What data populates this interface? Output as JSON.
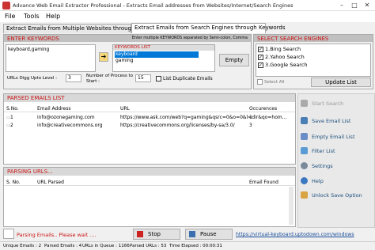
{
  "window": {
    "title": "Advance Web Email Extractor Professional - Extracts Email addresses from Websites/Internet/Search Engines",
    "minimize": "–",
    "maximize": "□",
    "close": "✕"
  },
  "menu": [
    "File",
    "Tools",
    "Help"
  ],
  "tabs": [
    "Extract Emails from Multiple Websites through URLs",
    "Extract Emails from Search Engines through Keywords"
  ],
  "keywords": {
    "header": "ENTER KEYWORDS",
    "hint": "Enter multiple KEYWORDS separated by Semi-colon, Comma",
    "input_value": "keyboard,gaming",
    "list_header": "KEYWORDS LIST",
    "list_items": [
      "keyboard",
      "gaming"
    ],
    "empty_label": "Empty",
    "arrow": "➔"
  },
  "search_engines": {
    "header": "SELECT SEARCH ENGINES",
    "items": [
      "1.Bing Search",
      "2.Yahoo Search",
      "3.Google Search"
    ],
    "select_all": "Select All",
    "update_list": "Update List"
  },
  "options": {
    "digg_label": "URLs Digg Upto Level :",
    "digg_value": "3",
    "process_label": "Number of Process to Start :",
    "process_value": "15",
    "duplicate_label": "List Duplicate Emails"
  },
  "parsed_emails": {
    "header": "PARSED EMAILS LIST",
    "columns": [
      "S.No.",
      "Email Address",
      "URL",
      "Occurences"
    ],
    "rows": [
      {
        "sno": "1",
        "email": "info@ozonegaming.com",
        "url": "https://www.ask.com/web?q=gaming&qsrc=0&o=0&l=dir&qo=hom...",
        "occ": "1"
      },
      {
        "sno": "2",
        "email": "info@creativecommons.org",
        "url": "https://creativecommons.org/licenses/by-sa/3.0/",
        "occ": "3"
      }
    ]
  },
  "parsing_urls": {
    "header": "PARSING URLS...",
    "columns": [
      "S. No.",
      "URL Parsed",
      "Email Found"
    ]
  },
  "sidebar": {
    "start_search": "Start Search",
    "save_email": "Save Email List",
    "empty_email": "Empty Email List",
    "filter": "Filter List",
    "settings": "Settings",
    "help": "Help",
    "unlock": "Unlock Save Option"
  },
  "bottom": {
    "status": "Parsing Emails.. Please wait ....",
    "stop": "Stop",
    "pause": "Pause",
    "link": "https://virtual-keyboard.uptodown.com/windows"
  },
  "statusbar": {
    "unique": "Unique Emails : 2",
    "parsed": "Parsed Emails : 4",
    "queue": "URLs in Queue : 1166",
    "parsed_urls": "Parsed URLs : 53",
    "time": "Time Elapsed : 00:00:31"
  },
  "colors": {
    "accent_red": "#cc1111",
    "link_blue": "#1a4d7a"
  }
}
